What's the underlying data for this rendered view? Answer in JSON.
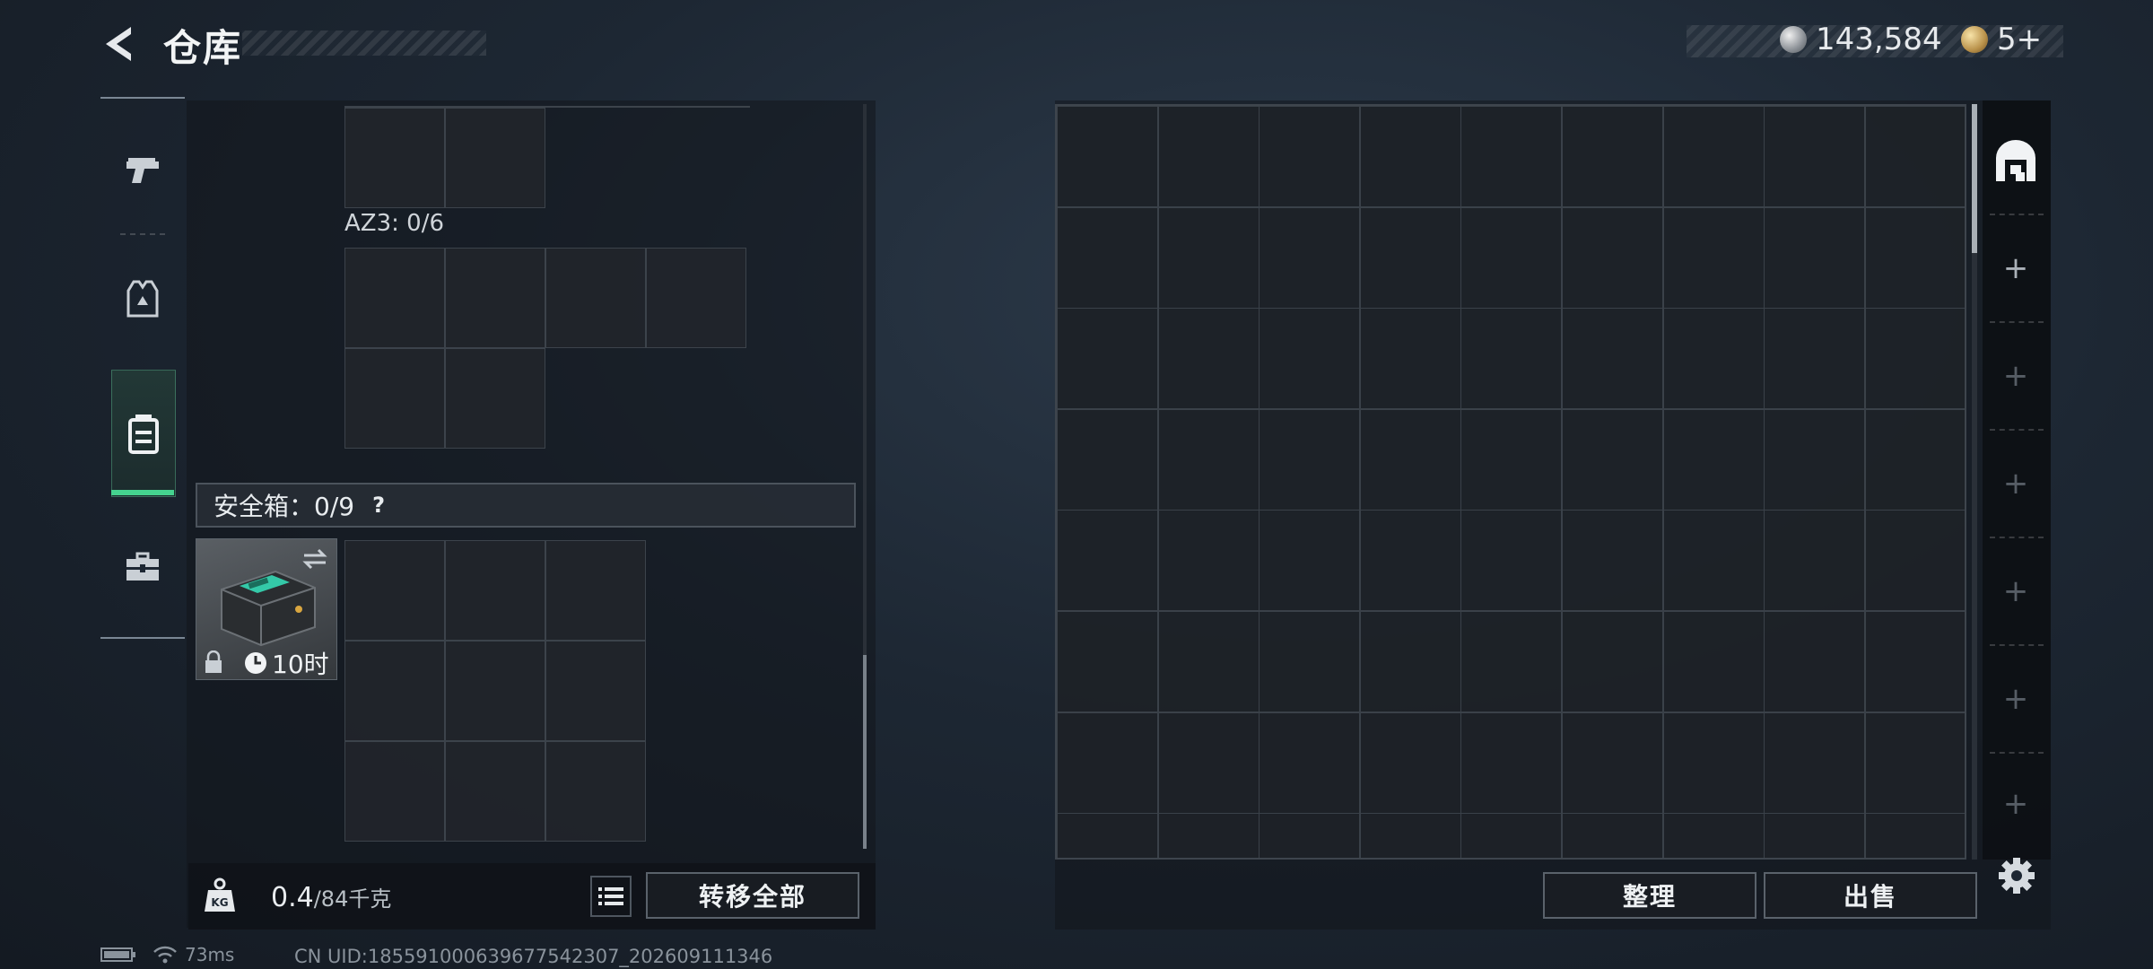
{
  "header": {
    "title": "仓库",
    "currency": [
      {
        "icon": "silver-coin-icon",
        "value": "143,584"
      },
      {
        "icon": "gold-token-icon",
        "value": "5+"
      }
    ]
  },
  "nav": {
    "items": [
      {
        "name": "weapons",
        "icon": "pistol-icon"
      },
      {
        "name": "armor",
        "icon": "vest-icon"
      },
      {
        "name": "backpack",
        "icon": "backpack-icon",
        "active": true
      },
      {
        "name": "toolbox",
        "icon": "toolbox-icon"
      }
    ]
  },
  "inventory": {
    "az3_label": "AZ3: 0/6",
    "safe_label": "安全箱：0/9",
    "safe_help": "?",
    "safe_timer": "10时"
  },
  "footer_left": {
    "weight_value": "0.4",
    "weight_max": "/84千克",
    "transfer_label": "转移全部"
  },
  "stash": {
    "sort_label": "整理",
    "sell_label": "出售",
    "tabs": [
      "main",
      "+",
      "+",
      "+",
      "+",
      "+",
      "+"
    ]
  },
  "status": {
    "ping": "73ms",
    "uid": "CN UID:185591000639677542307_202609111346"
  },
  "colors": {
    "accent_green": "#45d38f",
    "panel": "#1e2228"
  }
}
